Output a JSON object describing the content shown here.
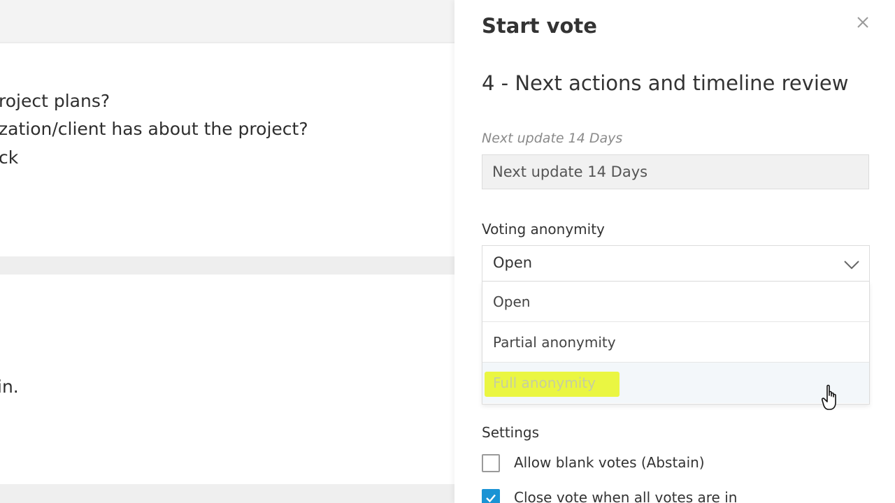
{
  "background": {
    "lines": [
      "roject plans?",
      "zation/client has about the project?",
      "ck",
      "in."
    ]
  },
  "panel": {
    "title": "Start vote",
    "agenda_item": "4 - Next actions and timeline review",
    "vote_title": {
      "label": "Next update 14 Days",
      "value": "Next update 14 Days"
    },
    "anonymity": {
      "label": "Voting anonymity",
      "selected": "Open",
      "options": [
        "Open",
        "Partial anonymity",
        "Full anonymity"
      ],
      "hovered": "Full anonymity"
    },
    "settings": {
      "label": "Settings",
      "items": [
        {
          "label": "Allow blank votes (Abstain)",
          "checked": false
        },
        {
          "label": "Close vote when all votes are in",
          "checked": true
        }
      ]
    }
  },
  "colors": {
    "accent": "#1a93d4",
    "highlight": "#eaf642"
  }
}
